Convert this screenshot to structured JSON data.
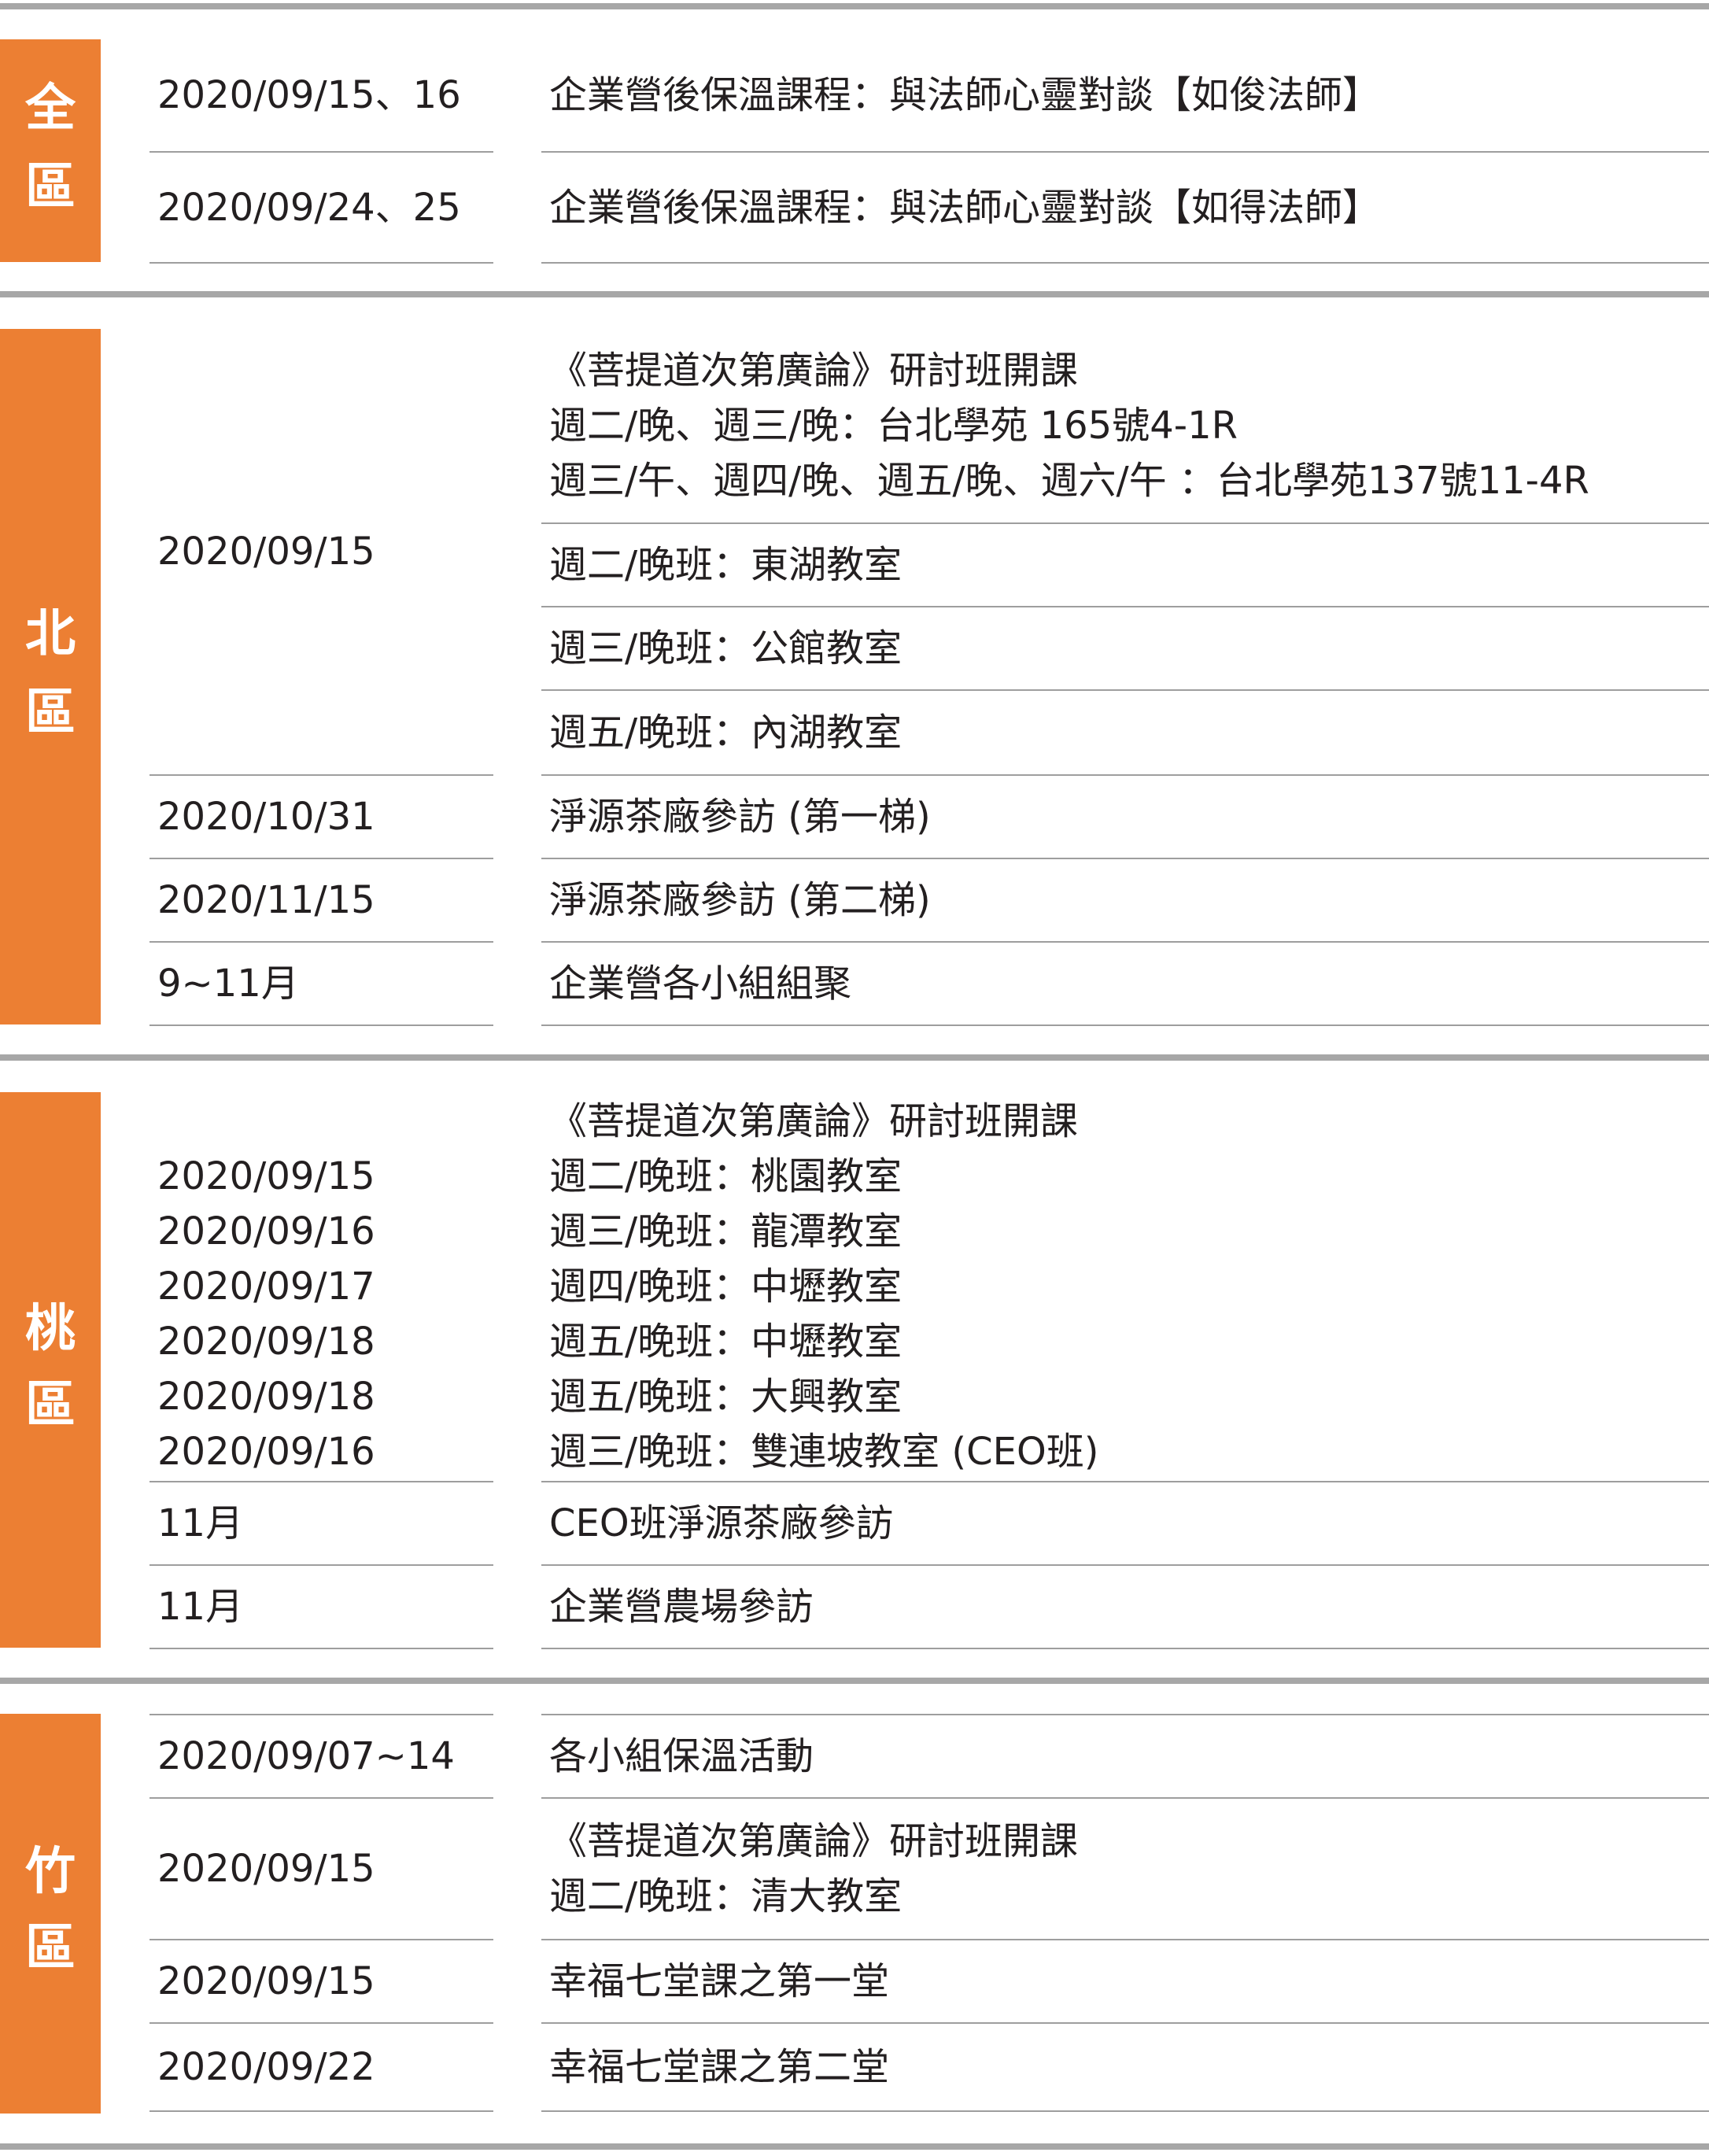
{
  "regions": {
    "quan": {
      "label": [
        "全",
        "區"
      ],
      "rows": [
        {
          "dates": "2020/09/15、16",
          "event": "企業營後保溫課程：與法師心靈對談【如俊法師】"
        },
        {
          "dates": "2020/09/24、25",
          "event": "企業營後保溫課程：與法師心靈對談【如得法師】"
        }
      ]
    },
    "bei": {
      "label": [
        "北",
        "區"
      ],
      "rows": [
        {
          "dates": "2020/09/15",
          "event": "《菩提道次第廣論》研討班開課\n週二/晚、週三/晚：台北學苑 165號4-1R\n週三/午、週四/晚、週五/晚、週六/午 ：台北學苑137號11-4R"
        },
        {
          "event": "週二/晚班：東湖教室"
        },
        {
          "event": "週三/晚班：公館教室"
        },
        {
          "event": "週五/晚班：內湖教室"
        },
        {
          "dates": "2020/10/31",
          "event": "淨源茶廠參訪 (第一梯)"
        },
        {
          "dates": "2020/11/15",
          "event": "淨源茶廠參訪 (第二梯)"
        },
        {
          "dates": "9~11月",
          "event": "企業營各小組組聚"
        }
      ]
    },
    "tao": {
      "label": [
        "桃",
        "區"
      ],
      "rows": [
        {
          "dates": "\n2020/09/15\n2020/09/16\n2020/09/17\n2020/09/18\n2020/09/18\n2020/09/16",
          "event": "《菩提道次第廣論》研討班開課\n週二/晚班：桃園教室\n週三/晚班：龍潭教室\n週四/晚班：中壢教室\n週五/晚班：中壢教室\n週五/晚班：大興教室\n週三/晚班：雙連坡教室 (CEO班)"
        },
        {
          "dates": "11月",
          "event": "CEO班淨源茶廠參訪"
        },
        {
          "dates": "11月",
          "event": "企業營農場參訪"
        }
      ]
    },
    "zhu": {
      "label": [
        "竹",
        "區"
      ],
      "rows": [
        {
          "dates": "2020/09/07~14",
          "event": "各小組保溫活動"
        },
        {
          "dates": "2020/09/15",
          "event": "《菩提道次第廣論》研討班開課\n週二/晚班：清大教室"
        },
        {
          "dates": "2020/09/15",
          "event": "幸福七堂課之第一堂"
        },
        {
          "dates": "2020/09/22",
          "event": "幸福七堂課之第二堂"
        }
      ]
    }
  }
}
